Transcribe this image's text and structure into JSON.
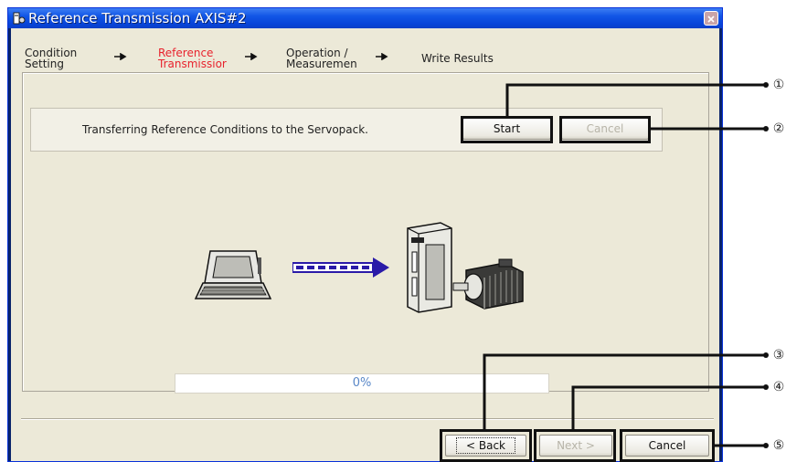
{
  "window": {
    "title": "Reference Transmission AXIS#2"
  },
  "steps": [
    {
      "label": "Condition\nSetting",
      "active": false
    },
    {
      "label": "Reference\nTransmissior",
      "active": true
    },
    {
      "label": "Operation /\nMeasuremen",
      "active": false
    },
    {
      "label": "Write Results",
      "active": false
    }
  ],
  "transfer": {
    "message": "Transferring Reference Conditions to the Servopack.",
    "start_label": "Start",
    "cancel_label": "Cancel"
  },
  "progress": {
    "value": 0,
    "text": "0%"
  },
  "footer": {
    "back_label": "< Back",
    "next_label": "Next >",
    "cancel_label": "Cancel"
  },
  "callouts": [
    "①",
    "②",
    "③",
    "④",
    "⑤"
  ],
  "colors": {
    "active_step": "#e8222d",
    "arrow": "#2a1aa8"
  },
  "icons": {
    "computer": "laptop-icon",
    "transfer_arrow": "dashed-arrow-icon",
    "servo": "servopack-motor-icon"
  }
}
